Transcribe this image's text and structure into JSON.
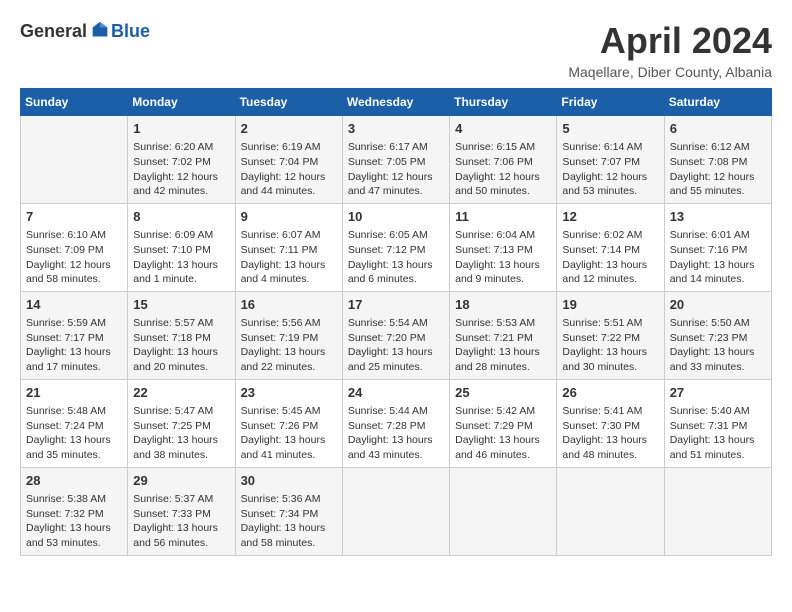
{
  "logo": {
    "general": "General",
    "blue": "Blue"
  },
  "title": "April 2024",
  "location": "Maqellare, Diber County, Albania",
  "weekdays": [
    "Sunday",
    "Monday",
    "Tuesday",
    "Wednesday",
    "Thursday",
    "Friday",
    "Saturday"
  ],
  "weeks": [
    [
      {
        "day": "",
        "content": ""
      },
      {
        "day": "1",
        "content": "Sunrise: 6:20 AM\nSunset: 7:02 PM\nDaylight: 12 hours\nand 42 minutes."
      },
      {
        "day": "2",
        "content": "Sunrise: 6:19 AM\nSunset: 7:04 PM\nDaylight: 12 hours\nand 44 minutes."
      },
      {
        "day": "3",
        "content": "Sunrise: 6:17 AM\nSunset: 7:05 PM\nDaylight: 12 hours\nand 47 minutes."
      },
      {
        "day": "4",
        "content": "Sunrise: 6:15 AM\nSunset: 7:06 PM\nDaylight: 12 hours\nand 50 minutes."
      },
      {
        "day": "5",
        "content": "Sunrise: 6:14 AM\nSunset: 7:07 PM\nDaylight: 12 hours\nand 53 minutes."
      },
      {
        "day": "6",
        "content": "Sunrise: 6:12 AM\nSunset: 7:08 PM\nDaylight: 12 hours\nand 55 minutes."
      }
    ],
    [
      {
        "day": "7",
        "content": "Sunrise: 6:10 AM\nSunset: 7:09 PM\nDaylight: 12 hours\nand 58 minutes."
      },
      {
        "day": "8",
        "content": "Sunrise: 6:09 AM\nSunset: 7:10 PM\nDaylight: 13 hours\nand 1 minute."
      },
      {
        "day": "9",
        "content": "Sunrise: 6:07 AM\nSunset: 7:11 PM\nDaylight: 13 hours\nand 4 minutes."
      },
      {
        "day": "10",
        "content": "Sunrise: 6:05 AM\nSunset: 7:12 PM\nDaylight: 13 hours\nand 6 minutes."
      },
      {
        "day": "11",
        "content": "Sunrise: 6:04 AM\nSunset: 7:13 PM\nDaylight: 13 hours\nand 9 minutes."
      },
      {
        "day": "12",
        "content": "Sunrise: 6:02 AM\nSunset: 7:14 PM\nDaylight: 13 hours\nand 12 minutes."
      },
      {
        "day": "13",
        "content": "Sunrise: 6:01 AM\nSunset: 7:16 PM\nDaylight: 13 hours\nand 14 minutes."
      }
    ],
    [
      {
        "day": "14",
        "content": "Sunrise: 5:59 AM\nSunset: 7:17 PM\nDaylight: 13 hours\nand 17 minutes."
      },
      {
        "day": "15",
        "content": "Sunrise: 5:57 AM\nSunset: 7:18 PM\nDaylight: 13 hours\nand 20 minutes."
      },
      {
        "day": "16",
        "content": "Sunrise: 5:56 AM\nSunset: 7:19 PM\nDaylight: 13 hours\nand 22 minutes."
      },
      {
        "day": "17",
        "content": "Sunrise: 5:54 AM\nSunset: 7:20 PM\nDaylight: 13 hours\nand 25 minutes."
      },
      {
        "day": "18",
        "content": "Sunrise: 5:53 AM\nSunset: 7:21 PM\nDaylight: 13 hours\nand 28 minutes."
      },
      {
        "day": "19",
        "content": "Sunrise: 5:51 AM\nSunset: 7:22 PM\nDaylight: 13 hours\nand 30 minutes."
      },
      {
        "day": "20",
        "content": "Sunrise: 5:50 AM\nSunset: 7:23 PM\nDaylight: 13 hours\nand 33 minutes."
      }
    ],
    [
      {
        "day": "21",
        "content": "Sunrise: 5:48 AM\nSunset: 7:24 PM\nDaylight: 13 hours\nand 35 minutes."
      },
      {
        "day": "22",
        "content": "Sunrise: 5:47 AM\nSunset: 7:25 PM\nDaylight: 13 hours\nand 38 minutes."
      },
      {
        "day": "23",
        "content": "Sunrise: 5:45 AM\nSunset: 7:26 PM\nDaylight: 13 hours\nand 41 minutes."
      },
      {
        "day": "24",
        "content": "Sunrise: 5:44 AM\nSunset: 7:28 PM\nDaylight: 13 hours\nand 43 minutes."
      },
      {
        "day": "25",
        "content": "Sunrise: 5:42 AM\nSunset: 7:29 PM\nDaylight: 13 hours\nand 46 minutes."
      },
      {
        "day": "26",
        "content": "Sunrise: 5:41 AM\nSunset: 7:30 PM\nDaylight: 13 hours\nand 48 minutes."
      },
      {
        "day": "27",
        "content": "Sunrise: 5:40 AM\nSunset: 7:31 PM\nDaylight: 13 hours\nand 51 minutes."
      }
    ],
    [
      {
        "day": "28",
        "content": "Sunrise: 5:38 AM\nSunset: 7:32 PM\nDaylight: 13 hours\nand 53 minutes."
      },
      {
        "day": "29",
        "content": "Sunrise: 5:37 AM\nSunset: 7:33 PM\nDaylight: 13 hours\nand 56 minutes."
      },
      {
        "day": "30",
        "content": "Sunrise: 5:36 AM\nSunset: 7:34 PM\nDaylight: 13 hours\nand 58 minutes."
      },
      {
        "day": "",
        "content": ""
      },
      {
        "day": "",
        "content": ""
      },
      {
        "day": "",
        "content": ""
      },
      {
        "day": "",
        "content": ""
      }
    ]
  ]
}
